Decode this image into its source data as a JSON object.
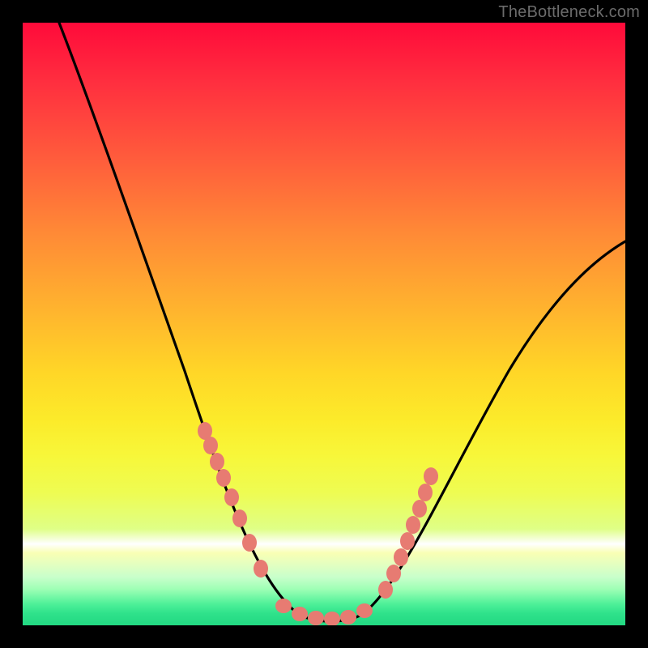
{
  "watermark": {
    "text": "TheBottleneck.com"
  },
  "colors": {
    "background": "#000000",
    "curve_stroke": "#000000",
    "bead_fill": "#e77b72",
    "gradient_stops": [
      "#ff0a3a",
      "#ff2f3f",
      "#ff5a3c",
      "#ff8a36",
      "#ffb52e",
      "#ffd627",
      "#fceb2a",
      "#f7f73a",
      "#eefc52",
      "#dfff86",
      "#ffffff",
      "#f9ffb4",
      "#e2ffc1",
      "#c8ffcb",
      "#9effb5",
      "#4df098",
      "#2fe28b",
      "#22d882"
    ]
  },
  "chart_data": {
    "type": "line",
    "title": "",
    "xlabel": "",
    "ylabel": "",
    "xlim": [
      0,
      100
    ],
    "ylim": [
      0,
      100
    ],
    "grid": false,
    "legend": false,
    "series": [
      {
        "name": "bottleneck-curve",
        "x": [
          6,
          10,
          15,
          20,
          25,
          28,
          30,
          32,
          34,
          36,
          38,
          40,
          42,
          44,
          46,
          48,
          52,
          56,
          60,
          65,
          72,
          80,
          90,
          100
        ],
        "y": [
          100,
          88,
          74,
          60,
          46,
          38,
          32,
          27,
          22,
          17,
          12,
          8,
          5,
          3,
          1.5,
          1,
          1,
          2.5,
          6,
          12,
          22,
          35,
          50,
          63
        ]
      }
    ],
    "annotations": {
      "beads_left": [
        [
          28,
          30
        ],
        [
          29,
          28
        ],
        [
          30.5,
          24
        ],
        [
          31.5,
          21
        ],
        [
          33,
          17
        ],
        [
          34.5,
          13
        ],
        [
          36.5,
          9
        ],
        [
          38.5,
          6
        ]
      ],
      "beads_floor": [
        [
          42,
          1.8
        ],
        [
          44,
          1.2
        ],
        [
          46.5,
          1
        ],
        [
          49,
          1
        ],
        [
          51.5,
          1.2
        ],
        [
          54,
          1.8
        ]
      ],
      "beads_right": [
        [
          57,
          4
        ],
        [
          58.5,
          6
        ],
        [
          60,
          8.5
        ],
        [
          61,
          11
        ],
        [
          62,
          13.5
        ],
        [
          63,
          16
        ],
        [
          64,
          18.5
        ],
        [
          65,
          21
        ]
      ]
    }
  }
}
